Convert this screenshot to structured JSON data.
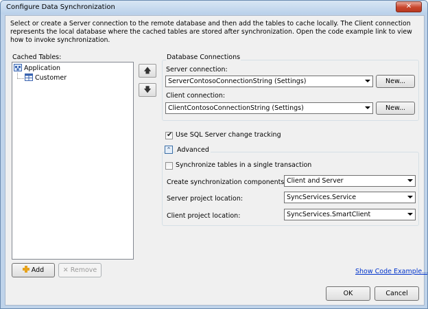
{
  "window": {
    "title": "Configure Data Synchronization",
    "close_glyph": "✕"
  },
  "description": "Select or create a Server connection to the remote database and then add the tables to cache locally. The Client connection represents the local database where the cached tables are stored after synchronization. Open the code example link to view how to invoke synchronization.",
  "cached_tables": {
    "label": "Cached Tables:",
    "tree": [
      {
        "label": "Application",
        "icon": "app-icon"
      },
      {
        "label": "Customer",
        "icon": "table-icon"
      }
    ],
    "add_label": "Add",
    "remove_label": "Remove",
    "move_up_glyph": "🡅",
    "move_down_glyph": "🡇"
  },
  "db_connections": {
    "group_label": "Database Connections",
    "server_label": "Server connection:",
    "server_value": "ServerContosoConnectionString (Settings)",
    "server_new": "New...",
    "client_label": "Client connection:",
    "client_value": "ClientContosoConnectionString (Settings)",
    "client_new": "New..."
  },
  "options": {
    "change_tracking_label": "Use SQL Server change tracking",
    "change_tracking_checked": true,
    "advanced_label": "Advanced",
    "advanced_toggle_glyph": "⌃",
    "single_transaction_label": "Synchronize tables in a single transaction",
    "single_transaction_checked": false,
    "components_label": "Create synchronization components:",
    "components_value": "Client and Server",
    "server_project_label": "Server project location:",
    "server_project_value": "SyncServices.Service",
    "client_project_label": "Client project location:",
    "client_project_value": "SyncServices.SmartClient"
  },
  "footer": {
    "show_code_link": "Show Code Example...",
    "ok_label": "OK",
    "cancel_label": "Cancel"
  },
  "colors": {
    "accent": "#0033cc",
    "close": "#c8452c"
  }
}
